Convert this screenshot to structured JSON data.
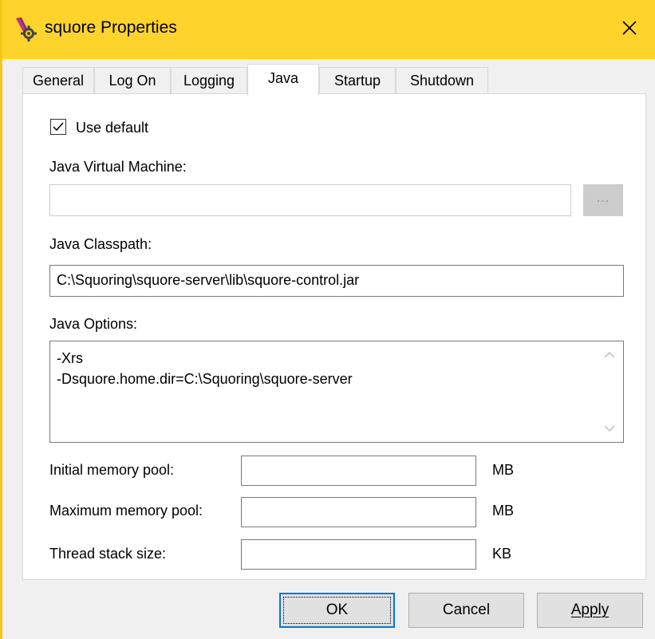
{
  "window": {
    "title": "squore Properties",
    "app_icon": "service-properties-icon",
    "close_icon": "close-icon"
  },
  "tabs": [
    {
      "label": "General",
      "active": false
    },
    {
      "label": "Log On",
      "active": false
    },
    {
      "label": "Logging",
      "active": false
    },
    {
      "label": "Java",
      "active": true
    },
    {
      "label": "Startup",
      "active": false
    },
    {
      "label": "Shutdown",
      "active": false
    }
  ],
  "java": {
    "use_default_label": "Use default",
    "use_default_checked": true,
    "jvm_label": "Java Virtual Machine:",
    "jvm_value": "",
    "browse_label": "...",
    "classpath_label": "Java Classpath:",
    "classpath_value": "C:\\Squoring\\squore-server\\lib\\squore-control.jar",
    "options_label": "Java Options:",
    "options_value": "-Xrs\n-Dsquore.home.dir=C:\\Squoring\\squore-server",
    "initial_memory_label": "Initial memory pool:",
    "initial_memory_value": "",
    "initial_memory_unit": "MB",
    "max_memory_label": "Maximum memory pool:",
    "max_memory_value": "",
    "max_memory_unit": "MB",
    "thread_stack_label": "Thread stack size:",
    "thread_stack_value": "",
    "thread_stack_unit": "KB"
  },
  "buttons": {
    "ok": "OK",
    "cancel": "Cancel",
    "apply": "Apply"
  },
  "colors": {
    "titlebar": "#fed32b",
    "default_button_border": "#0078d7"
  }
}
